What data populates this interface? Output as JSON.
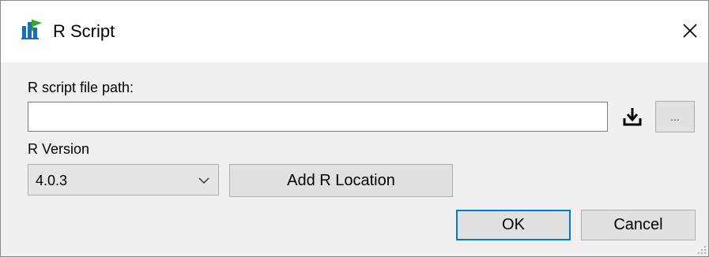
{
  "window": {
    "title": "R Script",
    "app_icon": "r-script-chart-icon",
    "close_glyph": "✕"
  },
  "form": {
    "path_label": "R script file path:",
    "path_value": "",
    "path_placeholder": "",
    "download_icon": "download-icon",
    "browse_label": "...",
    "version_label": "R Version",
    "version_selected": "4.0.3",
    "add_location_label": "Add R Location"
  },
  "footer": {
    "ok_label": "OK",
    "cancel_label": "Cancel"
  },
  "colors": {
    "focus_border": "#0078d7",
    "icon_blue": "#1a6fb3",
    "icon_green": "#2eaa3a"
  }
}
